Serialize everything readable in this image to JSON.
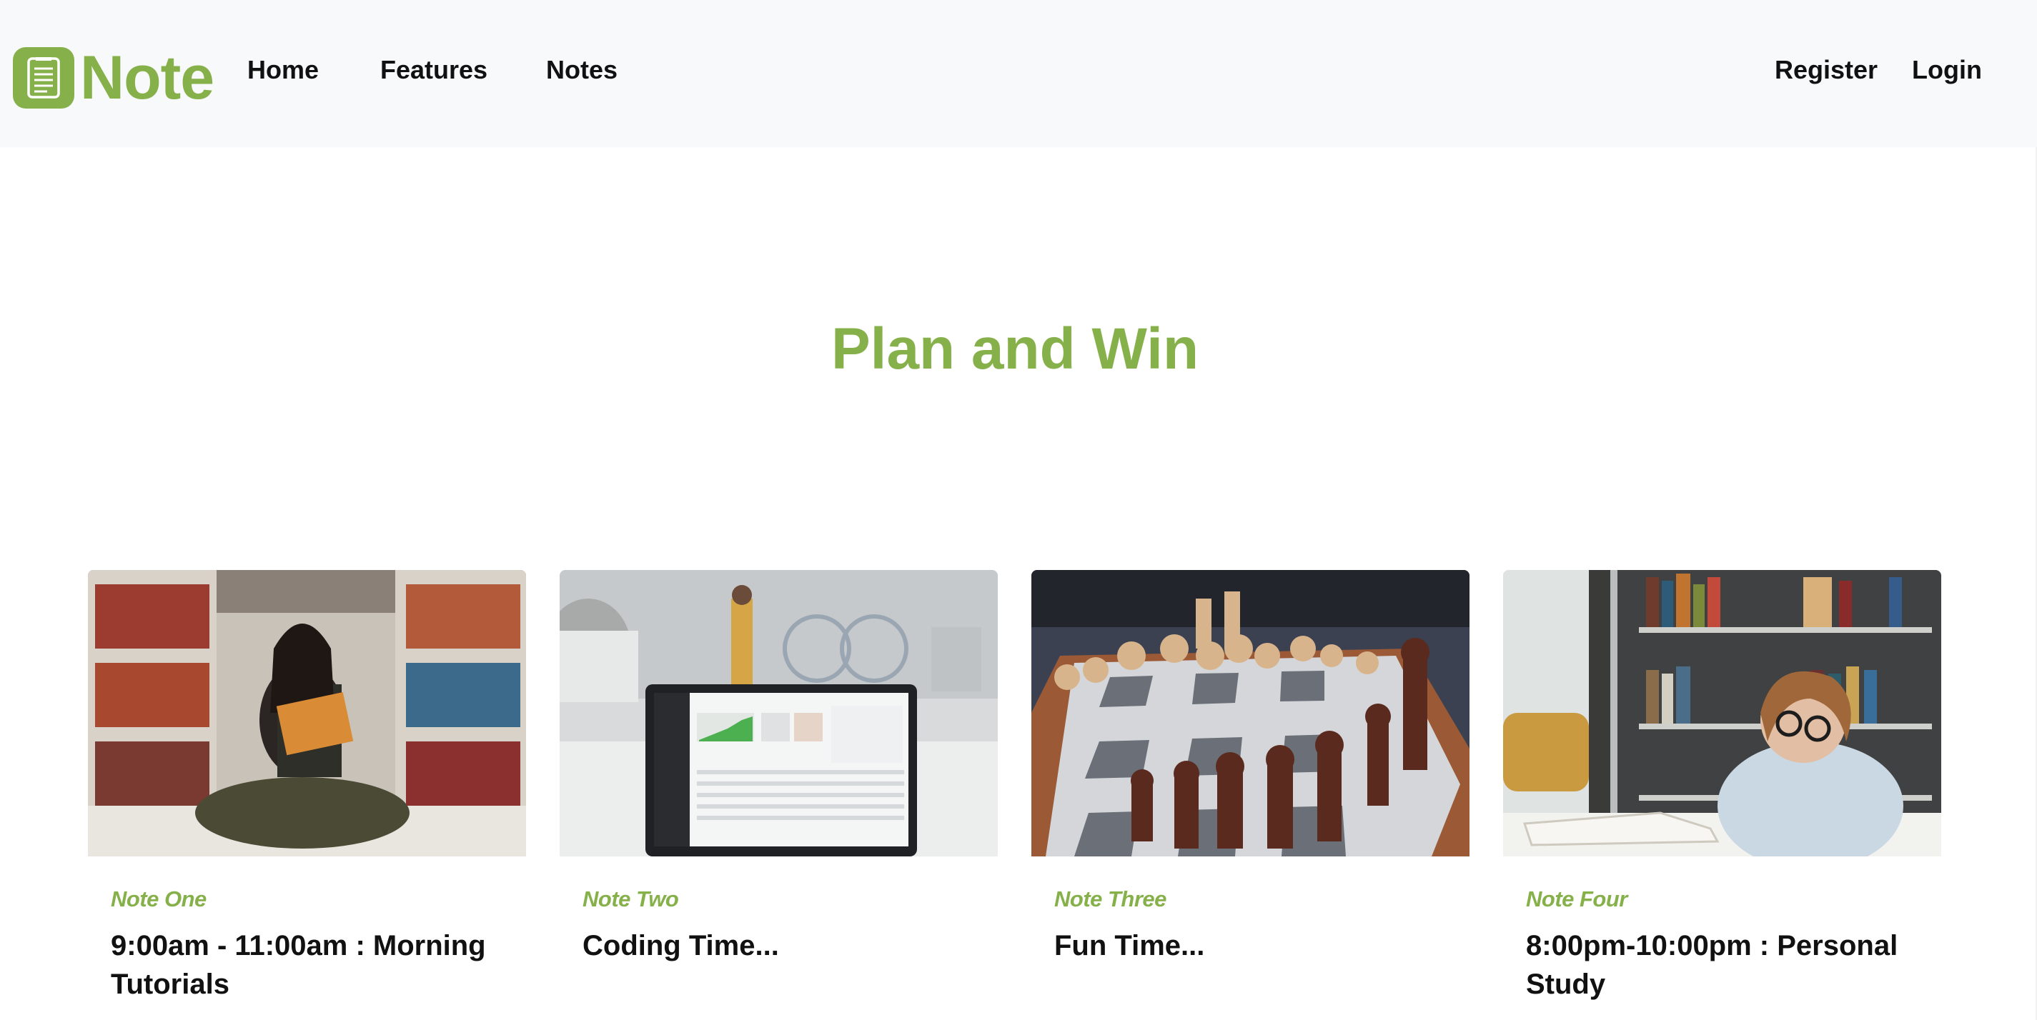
{
  "brand": {
    "name": "Note",
    "icon": "notepad-icon",
    "color": "#86b14a"
  },
  "nav": {
    "home": "Home",
    "features": "Features",
    "notes": "Notes",
    "register": "Register",
    "login": "Login"
  },
  "hero": {
    "title": "Plan and Win"
  },
  "cards": [
    {
      "tag": "Note One",
      "title": "9:00am - 11:00am : Morning Tutorials",
      "image": "reading-in-library-photo"
    },
    {
      "tag": "Note Two",
      "title": "Coding Time...",
      "image": "laptop-office-photo"
    },
    {
      "tag": "Note Three",
      "title": "Fun Time...",
      "image": "chess-board-photo"
    },
    {
      "tag": "Note Four",
      "title": "8:00pm-10:00pm : Personal Study",
      "image": "studying-at-desk-photo"
    }
  ],
  "colors": {
    "accent": "#86b14a",
    "navbar_bg": "#f8f9fa",
    "text": "#111111"
  }
}
